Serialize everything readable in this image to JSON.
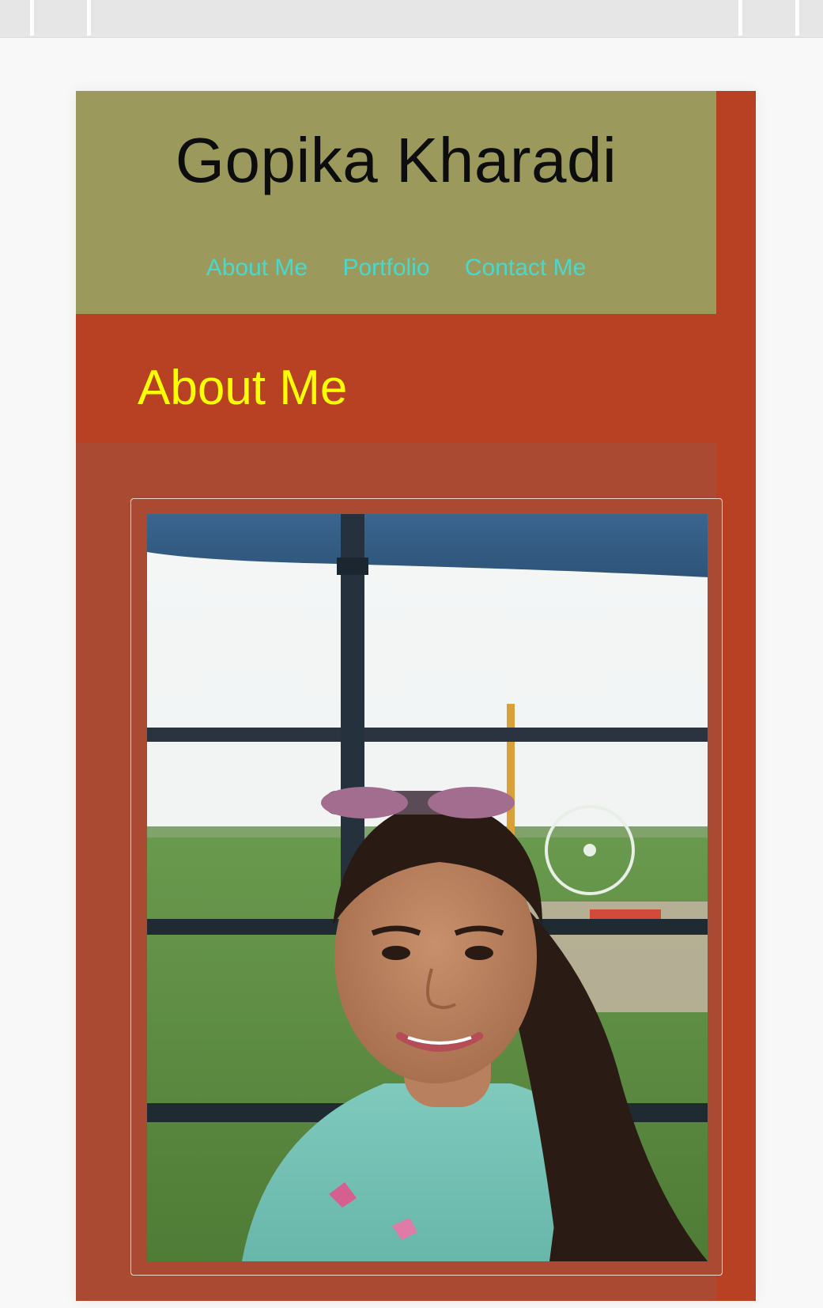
{
  "site": {
    "title": "Gopika Kharadi"
  },
  "nav": {
    "items": [
      {
        "label": "About Me"
      },
      {
        "label": "Portfolio"
      },
      {
        "label": "Contact Me"
      }
    ]
  },
  "section": {
    "title": "About Me"
  },
  "colors": {
    "header_bg": "#9b9a5c",
    "page_bg": "#b74122",
    "content_bg": "#ab4a33",
    "title_text": "#0d0d0d",
    "nav_link": "#47d9cf",
    "section_title": "#ffff00"
  },
  "photo": {
    "subject": "profile-photo"
  }
}
